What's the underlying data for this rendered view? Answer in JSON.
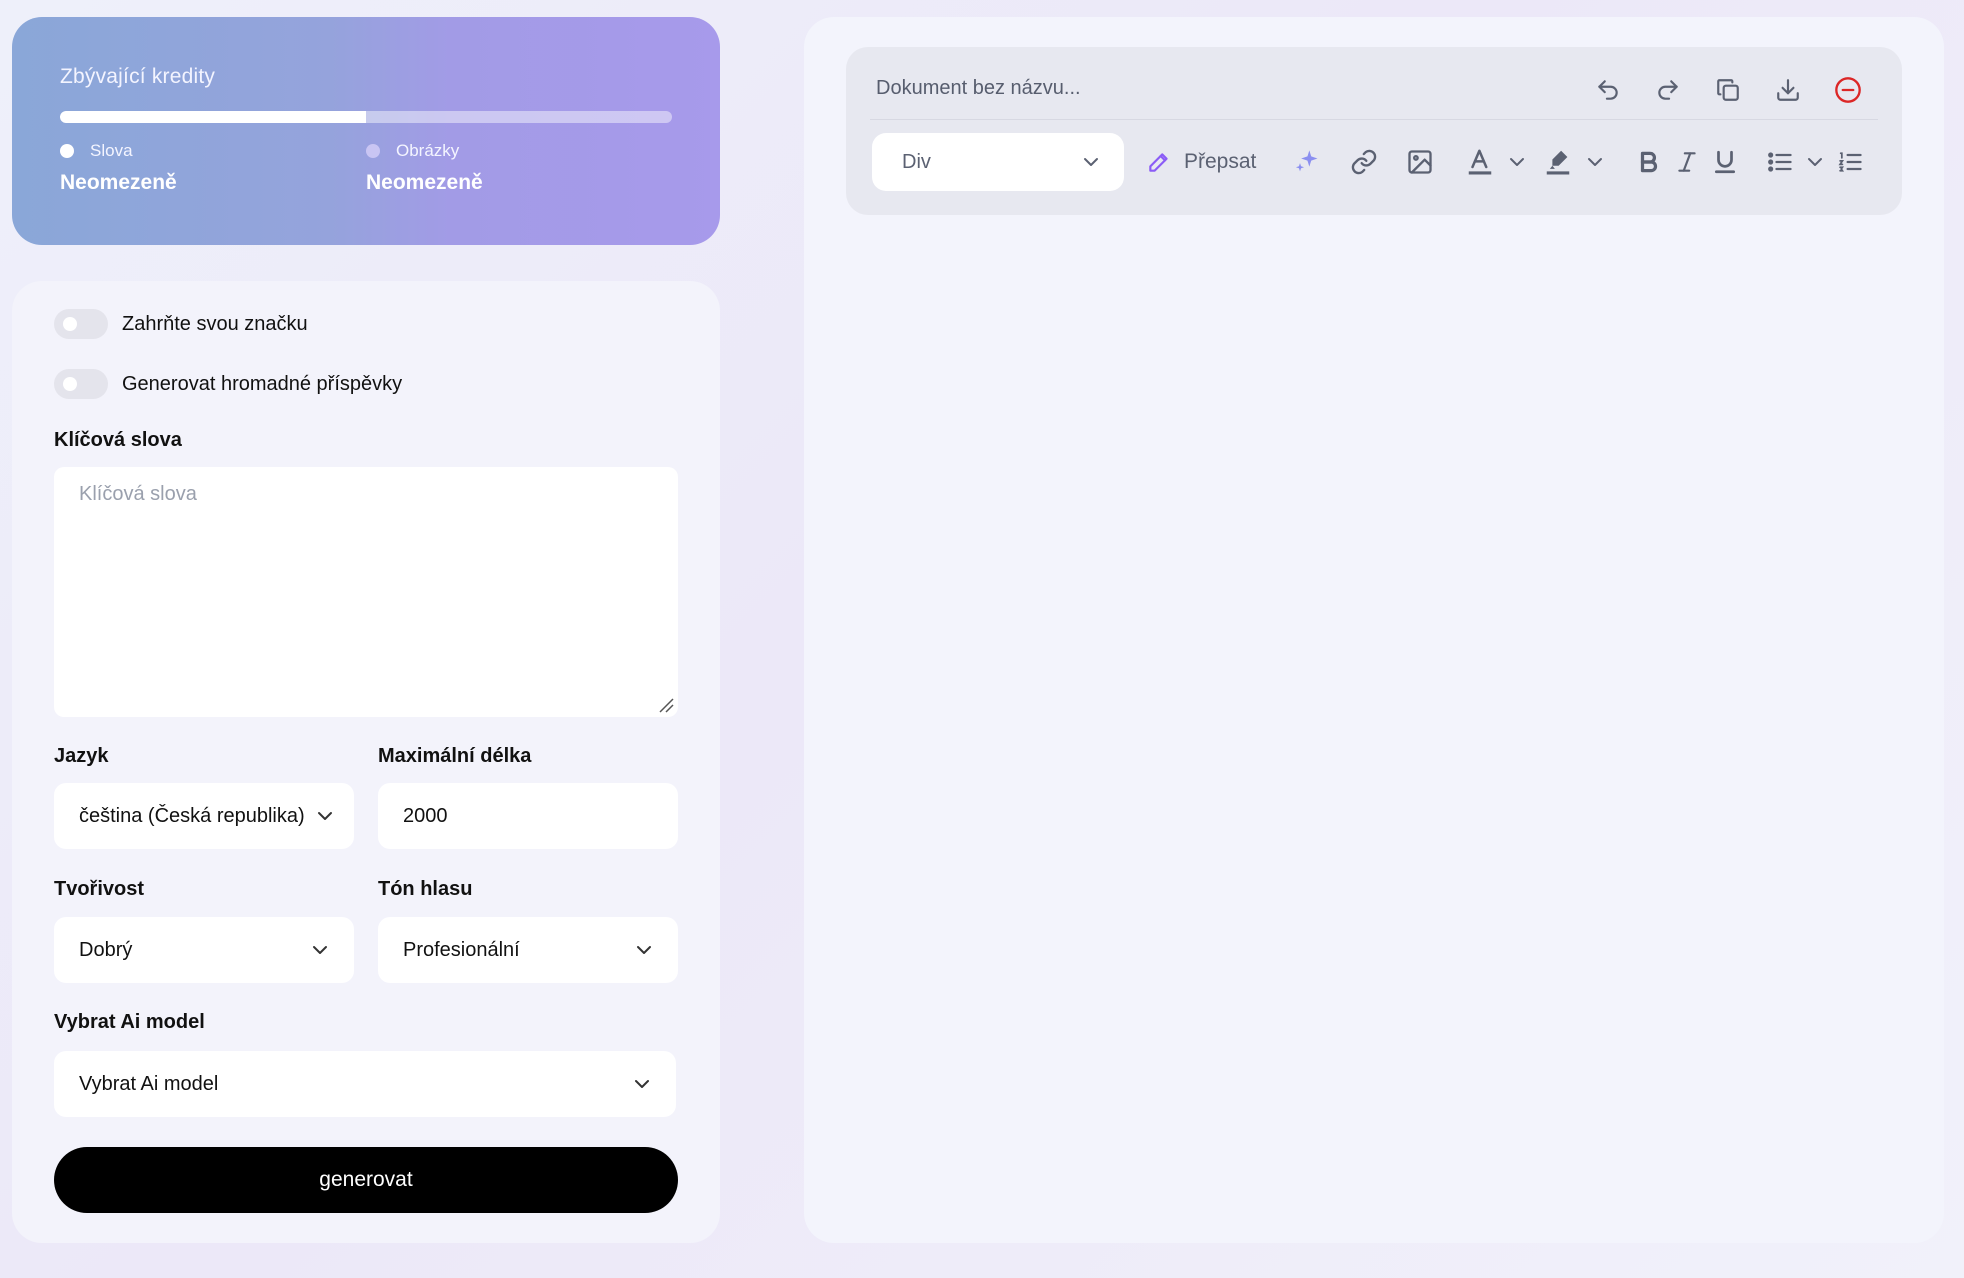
{
  "credits": {
    "title": "Zbývající kredity",
    "progress": 0.5,
    "words_label": "Slova",
    "words_value": "Neomezeně",
    "images_label": "Obrázky",
    "images_value": "Neomezeně"
  },
  "form": {
    "brand_toggle_label": "Zahrňte svou značku",
    "bulk_toggle_label": "Generovat hromadné příspěvky",
    "keywords_label": "Klíčová slova",
    "keywords_placeholder": "Klíčová slova",
    "language_label": "Jazyk",
    "language_value": "čeština (Česká republika)",
    "max_length_label": "Maximální délka",
    "max_length_value": "2000",
    "creativity_label": "Tvořivost",
    "creativity_value": "Dobrý",
    "tone_label": "Tón hlasu",
    "tone_value": "Profesionální",
    "model_label": "Vybrat Ai model",
    "model_value": "Vybrat Ai model",
    "generate_label": "generovat"
  },
  "editor": {
    "document_title_placeholder": "Dokument bez názvu...",
    "block_type": "Div",
    "rewrite_label": "Přepsat",
    "icons": [
      "undo-icon",
      "redo-icon",
      "copy-icon",
      "download-icon",
      "remove-icon",
      "pencil-icon",
      "sparkle-icon",
      "link-icon",
      "image-icon",
      "text-color-icon",
      "highlight-icon",
      "bold-icon",
      "italic-icon",
      "underline-icon",
      "bullet-list-icon",
      "numbered-list-icon"
    ],
    "colors": {
      "accent": "#8b5cf6",
      "danger": "#dc2626",
      "icon": "#5b6172"
    }
  }
}
